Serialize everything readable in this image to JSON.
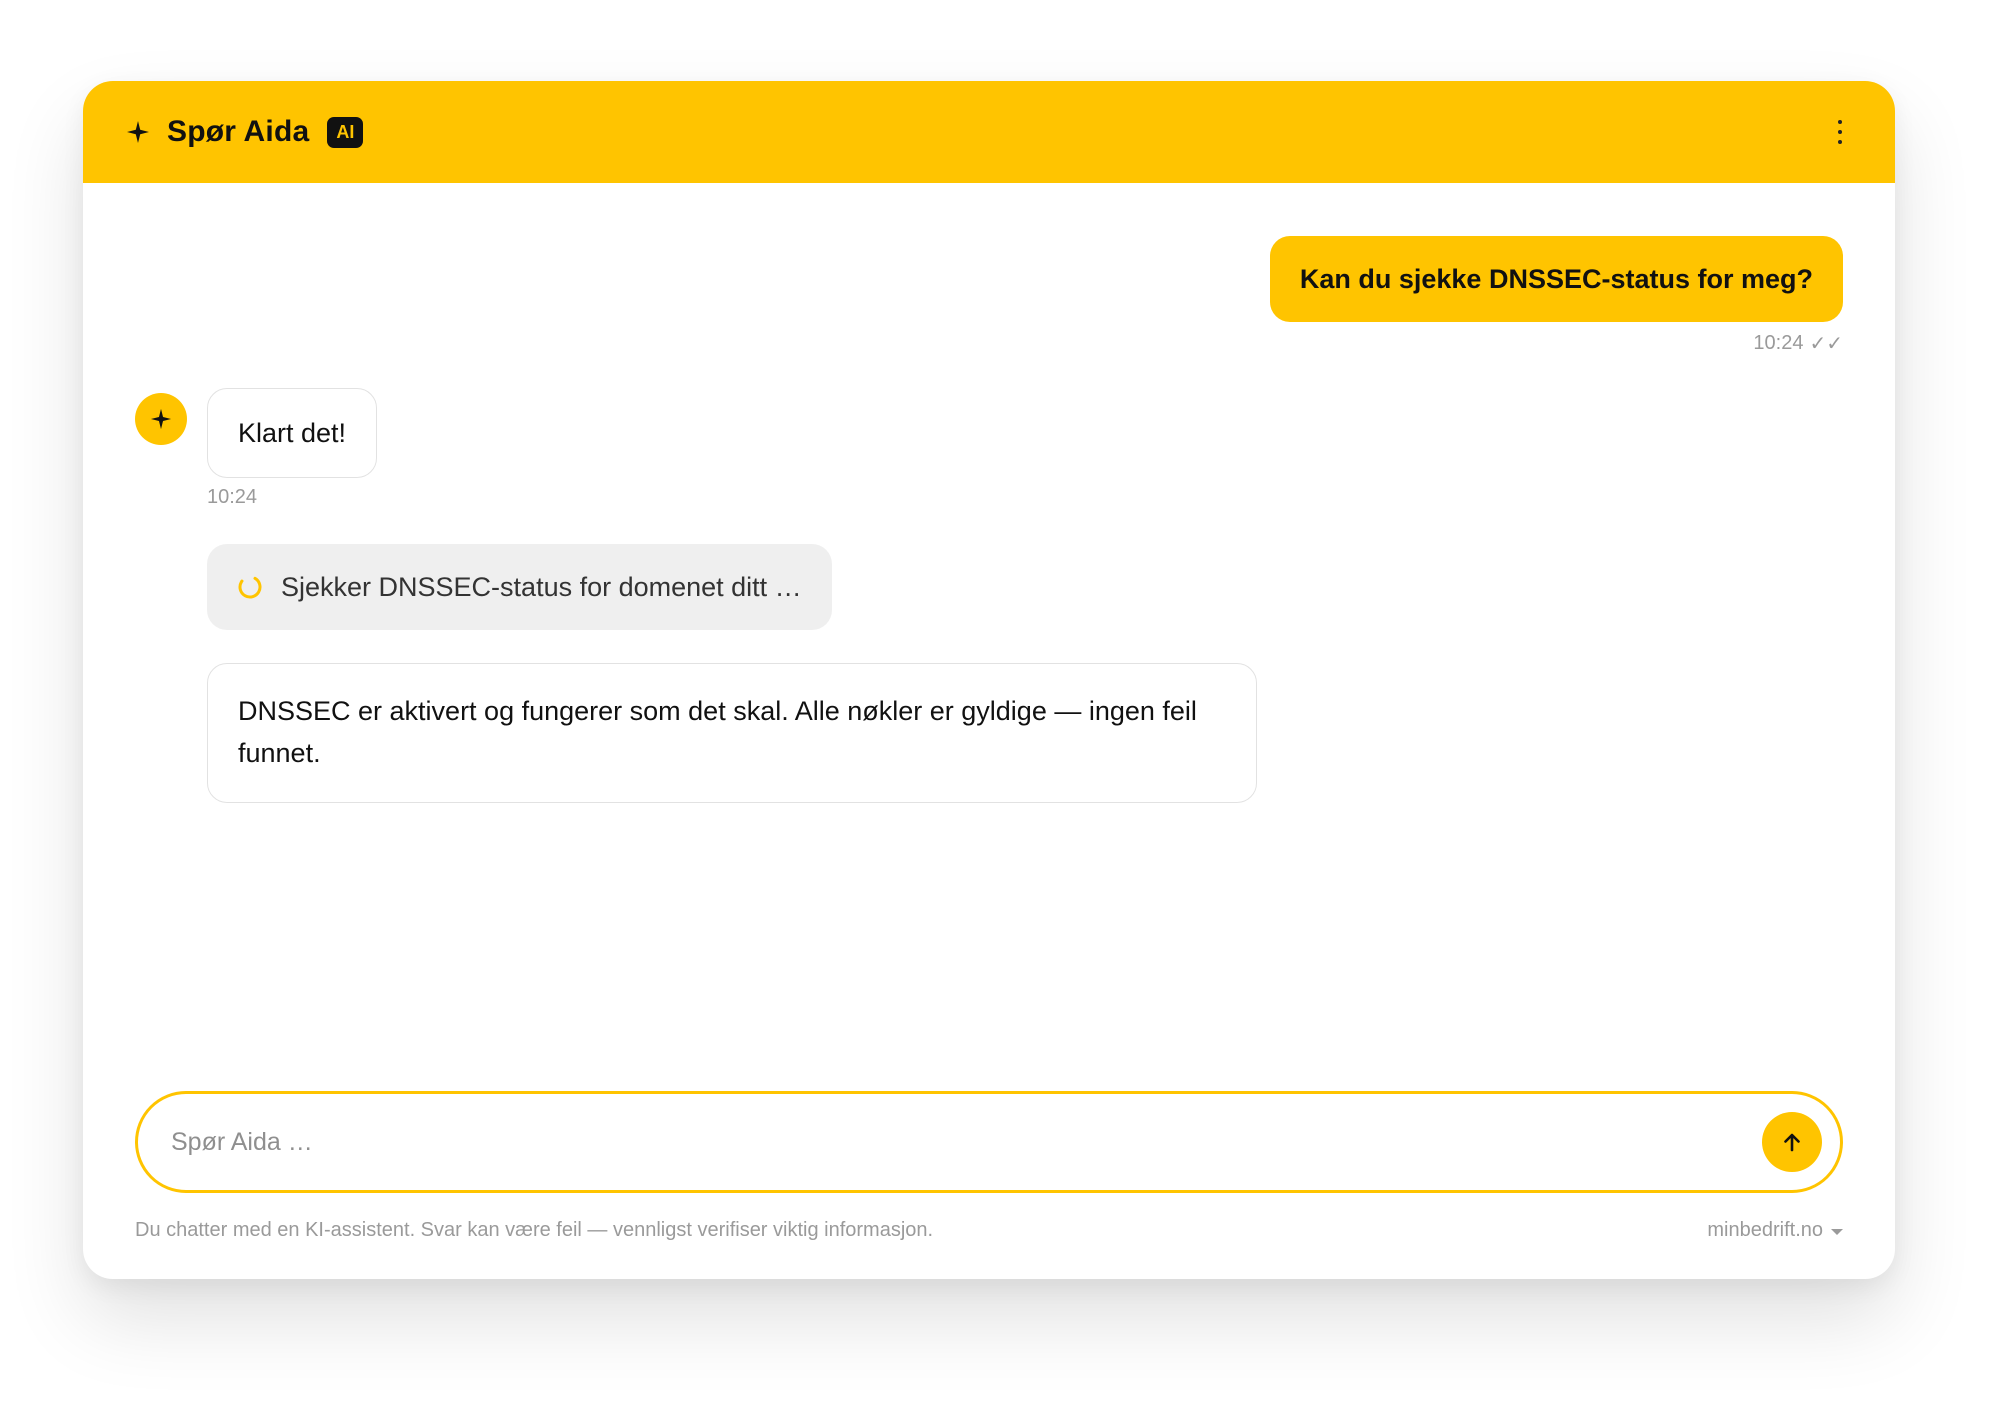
{
  "header": {
    "title": "Spør Aida",
    "badge": "AI",
    "sparkle_icon": "sparkle-icon",
    "menu_icon": "kebab-menu-icon"
  },
  "messages": {
    "user": {
      "text": "Kan du sjekke DNSSEC-status for meg?",
      "time": "10:24",
      "receipt": "✓✓"
    },
    "bot_reply": {
      "text": "Klart det!",
      "time": "10:24"
    },
    "status": {
      "text": "Sjekker DNSSEC-status for domenet ditt …"
    },
    "bot_result": {
      "text": "DNSSEC er aktivert og fungerer som det skal. Alle nøkler er gyldige — ingen feil funnet."
    }
  },
  "composer": {
    "placeholder": "Spør Aida …",
    "value": "",
    "send_icon": "arrow-up-icon"
  },
  "footer": {
    "disclaimer": "Du chatter med en KI-assistent. Svar kan være feil — vennligst verifiser viktig informasjon.",
    "domain": "minbedrift.no"
  },
  "colors": {
    "accent": "#FFC400",
    "text": "#111111",
    "muted": "#9a9a9a",
    "status_bg": "#efefef"
  }
}
